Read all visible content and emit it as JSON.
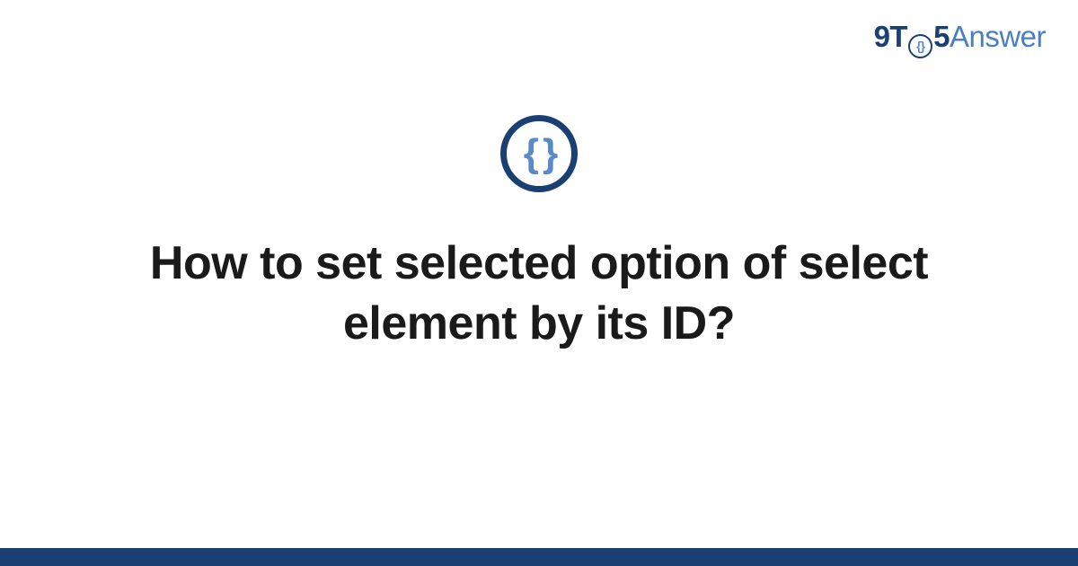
{
  "logo": {
    "part1": "9T",
    "part2": "5",
    "part3": "Answer",
    "braces_small": "{}"
  },
  "topic_icon": {
    "braces": "{ }"
  },
  "title": "How to set selected option of select element by its ID?",
  "colors": {
    "dark_blue": "#1a3f73",
    "light_blue": "#5a8bc9",
    "brand_blue": "#4a7fc4"
  }
}
